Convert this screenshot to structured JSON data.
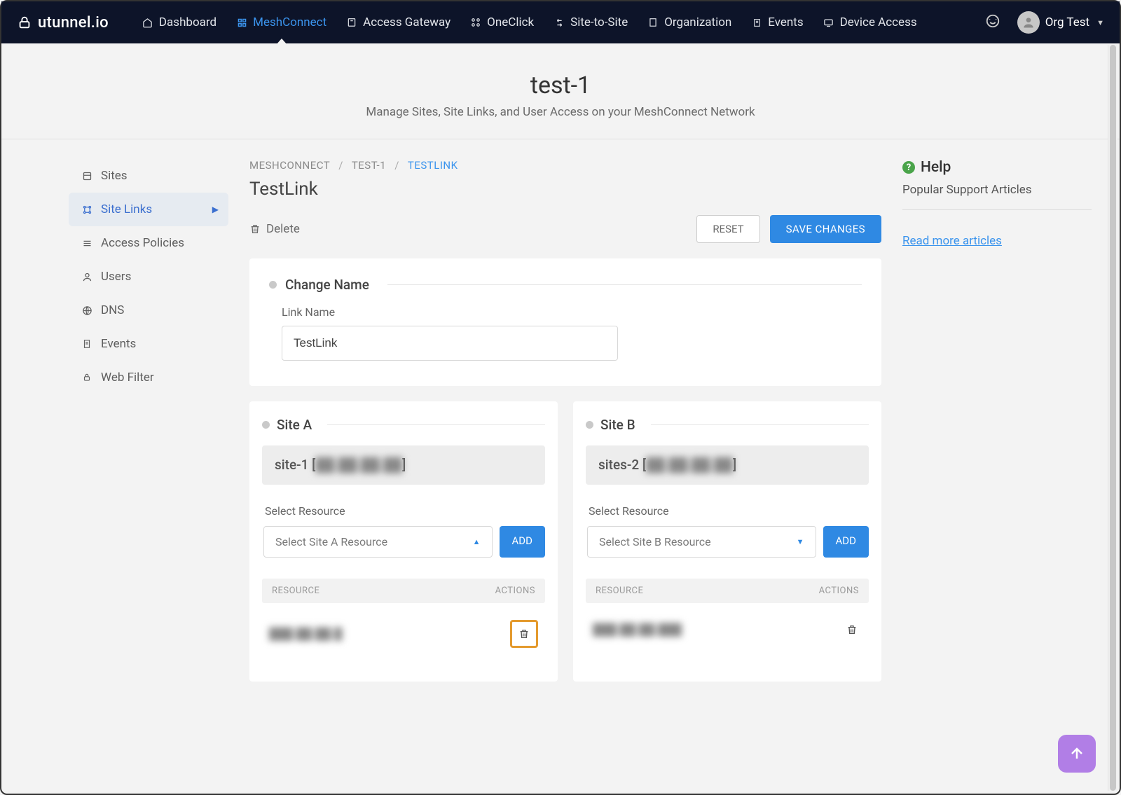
{
  "brand": "utunnel.io",
  "nav": [
    {
      "label": "Dashboard",
      "icon": "home"
    },
    {
      "label": "MeshConnect",
      "icon": "mesh",
      "active": true
    },
    {
      "label": "Access Gateway",
      "icon": "gateway"
    },
    {
      "label": "OneClick",
      "icon": "oneclick"
    },
    {
      "label": "Site-to-Site",
      "icon": "s2s"
    },
    {
      "label": "Organization",
      "icon": "org"
    },
    {
      "label": "Events",
      "icon": "events"
    },
    {
      "label": "Device Access",
      "icon": "device"
    }
  ],
  "user": {
    "name": "Org Test"
  },
  "page": {
    "title": "test-1",
    "subtitle": "Manage Sites, Site Links, and User Access on your MeshConnect Network"
  },
  "sidebar": {
    "items": [
      {
        "label": "Sites",
        "icon": "sites"
      },
      {
        "label": "Site Links",
        "icon": "links",
        "active": true
      },
      {
        "label": "Access Policies",
        "icon": "policies"
      },
      {
        "label": "Users",
        "icon": "users"
      },
      {
        "label": "DNS",
        "icon": "dns"
      },
      {
        "label": "Events",
        "icon": "events"
      },
      {
        "label": "Web Filter",
        "icon": "filter"
      }
    ]
  },
  "breadcrumb": {
    "items": [
      {
        "label": "MESHCONNECT"
      },
      {
        "label": "TEST-1"
      },
      {
        "label": "TESTLINK",
        "current": true
      }
    ]
  },
  "section_title": "TestLink",
  "actions": {
    "delete": "Delete",
    "reset": "RESET",
    "save": "SAVE CHANGES"
  },
  "change_name": {
    "heading": "Change Name",
    "label": "Link Name",
    "value": "TestLink"
  },
  "site_a": {
    "heading": "Site A",
    "name_prefix": "site-1 [",
    "name_blur": "██.██.██.██",
    "name_suffix": "]",
    "select_label": "Select Resource",
    "select_placeholder": "Select Site A Resource",
    "dropdown_open": true,
    "add": "ADD",
    "table": {
      "resource_hdr": "RESOURCE",
      "actions_hdr": "ACTIONS",
      "rows": [
        {
          "value": "███.██.██.█",
          "highlight": true
        }
      ]
    }
  },
  "site_b": {
    "heading": "Site B",
    "name_prefix": "sites-2 [",
    "name_blur": "██.██.██.██",
    "name_suffix": "]",
    "select_label": "Select Resource",
    "select_placeholder": "Select Site B Resource",
    "dropdown_open": false,
    "add": "ADD",
    "table": {
      "resource_hdr": "RESOURCE",
      "actions_hdr": "ACTIONS",
      "rows": [
        {
          "value": "███.██.██.███",
          "highlight": false
        }
      ]
    }
  },
  "help": {
    "title": "Help",
    "subtitle": "Popular Support Articles",
    "link": "Read more articles"
  }
}
